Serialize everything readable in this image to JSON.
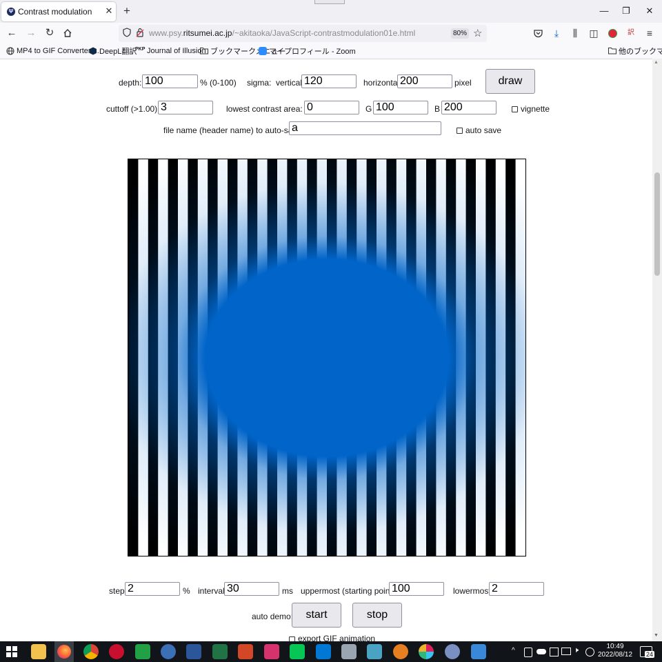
{
  "browser": {
    "tab_title": "Contrast modulation",
    "url_prefix": "www.psy.",
    "url_domain": "ritsumei.ac.jp",
    "url_path": "/~akitaoka/JavaScript-contrastmodulation01e.html",
    "zoom": "80%",
    "bookmarks": [
      {
        "label": "MP4 to GIF Converter ...",
        "icon": "globe-icon"
      },
      {
        "label": "DeepL翻訳",
        "icon": "deepl-icon"
      },
      {
        "label": "Journal of Illusion",
        "icon": "jpe-icon"
      },
      {
        "label": "ブックマークメニュー",
        "icon": "folder-icon"
      },
      {
        "label": "マイプロフィール - Zoom",
        "icon": "zoom-icon"
      }
    ],
    "other_bookmarks": "他のブックマーク"
  },
  "controls": {
    "depth_label": "depth:",
    "depth_value": "100",
    "depth_unit": "% (0-100)",
    "sigma_label": "sigma:",
    "vertical_label": "vertical",
    "vertical_value": "120",
    "horizontal_label": "horizontal",
    "horizontal_value": "200",
    "pixel_label": "pixel",
    "draw_label": "draw",
    "cutoff_label": "cuttoff (>1.00)",
    "cutoff_value": "3",
    "lowest_label": "lowest contrast area: R",
    "r_value": "0",
    "g_label": "G",
    "g_value": "100",
    "b_label": "B",
    "b_value": "200",
    "vignette_label": "vignette",
    "filename_label": "file name (header name) to auto-save",
    "filename_value": "a",
    "autosave_label": "auto save"
  },
  "stimulus": {
    "stripe_count": 20,
    "ellipse_color": "#0064c8",
    "stripe_dark": "#000000",
    "stripe_light": "#ffffff"
  },
  "demo": {
    "step_label": "step",
    "step_value": "2",
    "step_unit": "%",
    "interval_label": "interval",
    "interval_value": "30",
    "interval_unit": "ms",
    "uppermost_label": "uppermost (starting point)",
    "uppermost_value": "100",
    "lowermost_label": "lowermost",
    "lowermost_value": "2",
    "auto_demo_label": "auto demo:",
    "start_label": "start",
    "stop_label": "stop",
    "export_label": "export GIF animation"
  },
  "taskbar": {
    "time": "10:49",
    "date": "2022/08/12",
    "notifications": "24"
  }
}
